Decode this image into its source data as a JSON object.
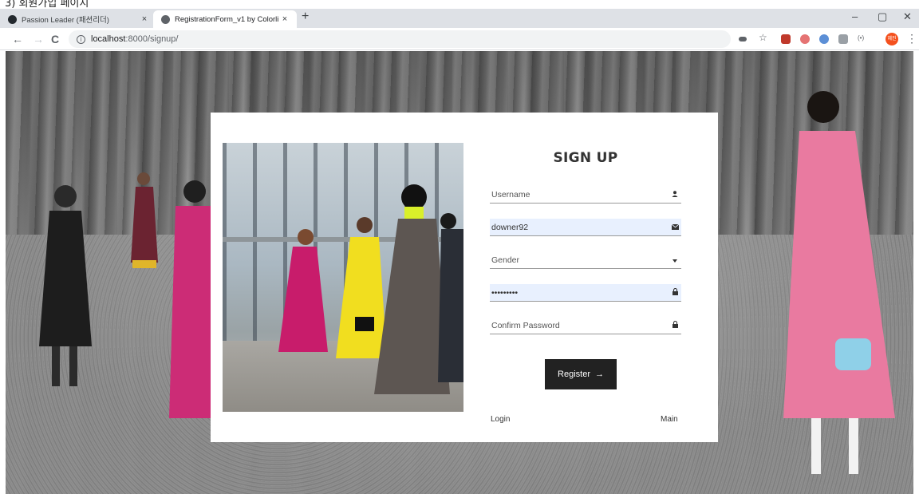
{
  "caption_text": "3) 회원가입 페이지",
  "browser": {
    "tabs": [
      {
        "label": "Passion Leader (패션리더)",
        "active": false
      },
      {
        "label": "RegistrationForm_v1 by Colorlib",
        "active": true
      }
    ],
    "tab_close_glyph": "×",
    "new_tab_glyph": "+",
    "window_controls": {
      "minimize": "–",
      "maximize": "▢",
      "close": "✕"
    },
    "nav": {
      "back": "←",
      "forward": "→",
      "reload": "C"
    },
    "url": {
      "host": "localhost",
      "path": ":8000/signup/"
    },
    "profile_initials": "혜진"
  },
  "form": {
    "title": "SIGN UP",
    "username_placeholder": "Username",
    "email_value": "downer92",
    "gender_placeholder": "Gender",
    "password_value": "•••••••••",
    "confirm_password_placeholder": "Confirm Password",
    "register_label": "Register",
    "register_arrow": "→",
    "login_link": "Login",
    "main_link": "Main"
  },
  "icons": {
    "user": "user-icon",
    "email": "envelope-icon",
    "dropdown": "chevron-down-icon",
    "lock": "lock-icon"
  },
  "colors": {
    "button_bg": "#222222",
    "autofill_bg": "#e8f0fe",
    "card_bg": "#ffffff"
  }
}
